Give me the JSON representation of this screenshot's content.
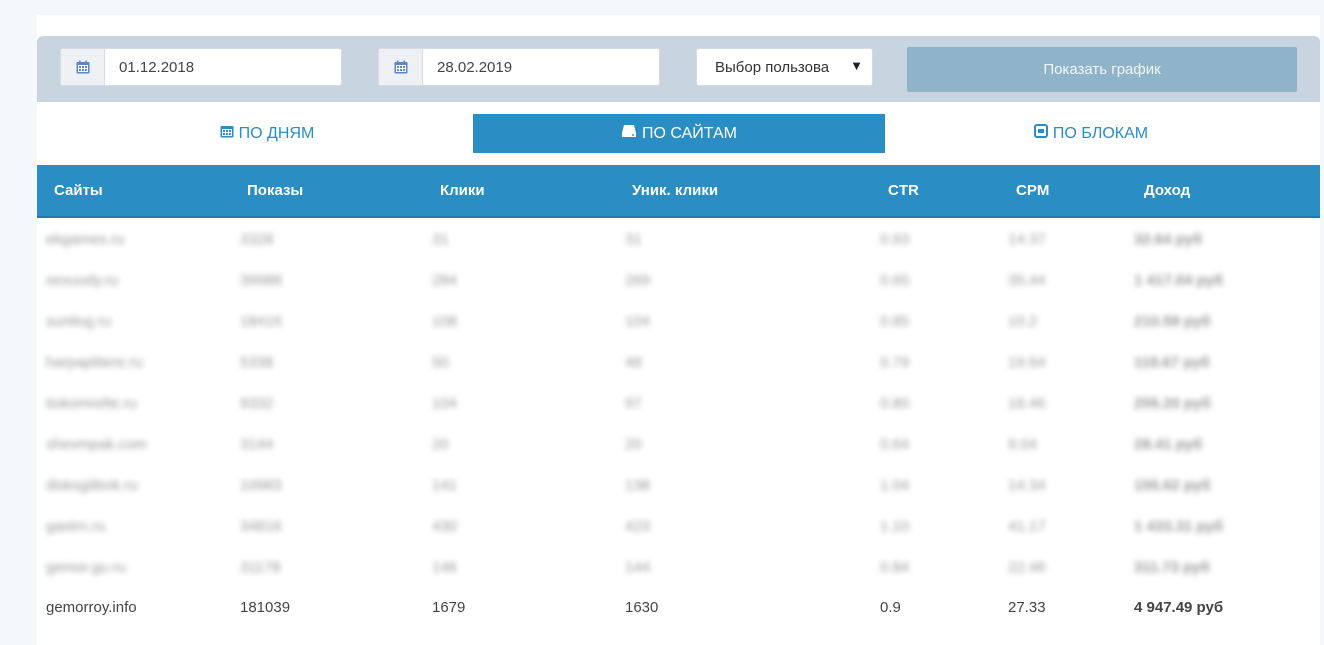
{
  "filters": {
    "date_from": "01.12.2018",
    "date_to": "28.02.2019",
    "user_select": "Выбор пользова",
    "show_chart": "Показать график"
  },
  "tabs": [
    {
      "label": "ПО ДНЯМ",
      "icon": "calendar-icon"
    },
    {
      "label": "ПО САЙТАМ",
      "icon": "server-icon",
      "active": true
    },
    {
      "label": "ПО БЛОКАМ",
      "icon": "block-icon"
    }
  ],
  "table": {
    "headers": [
      "Сайты",
      "Показы",
      "Клики",
      "Уник. клики",
      "CTR",
      "CPM",
      "Доход"
    ],
    "blurred_rows": [
      [
        "ekgames.ru",
        "3328",
        "31",
        "31",
        "0.93",
        "14.37",
        "32.64 руб"
      ],
      [
        "sexuudy.ru",
        "39988",
        "284",
        "269",
        "0.65",
        "35.44",
        "1 417.04 руб"
      ],
      [
        "sunilog.ru",
        "18416",
        "108",
        "104",
        "0.85",
        "10.2",
        "210.59 руб"
      ],
      [
        "harpaplitere.ru",
        "5338",
        "50",
        "48",
        "0.79",
        "19.64",
        "118.67 руб"
      ],
      [
        "tiokomrelte.ru",
        "9332",
        "104",
        "97",
        "0.80",
        "16.46",
        "255.20 руб"
      ],
      [
        "shevmpak.com",
        "3144",
        "20",
        "20",
        "0.64",
        "9.04",
        "28.41 руб"
      ],
      [
        "disksgitbok.ru",
        "10983",
        "141",
        "138",
        "1.04",
        "14.34",
        "155.62 руб"
      ],
      [
        "gastrn.ru",
        "34816",
        "430",
        "423",
        "1.10",
        "41.17",
        "1 433.31 руб"
      ],
      [
        "gemor.gu.ru",
        "31178",
        "146",
        "144",
        "0.84",
        "22.46",
        "311.73 руб"
      ]
    ],
    "last_row": [
      "gemorroy.info",
      "181039",
      "1679",
      "1630",
      "0.9",
      "27.33",
      "4 947.49 руб"
    ]
  }
}
